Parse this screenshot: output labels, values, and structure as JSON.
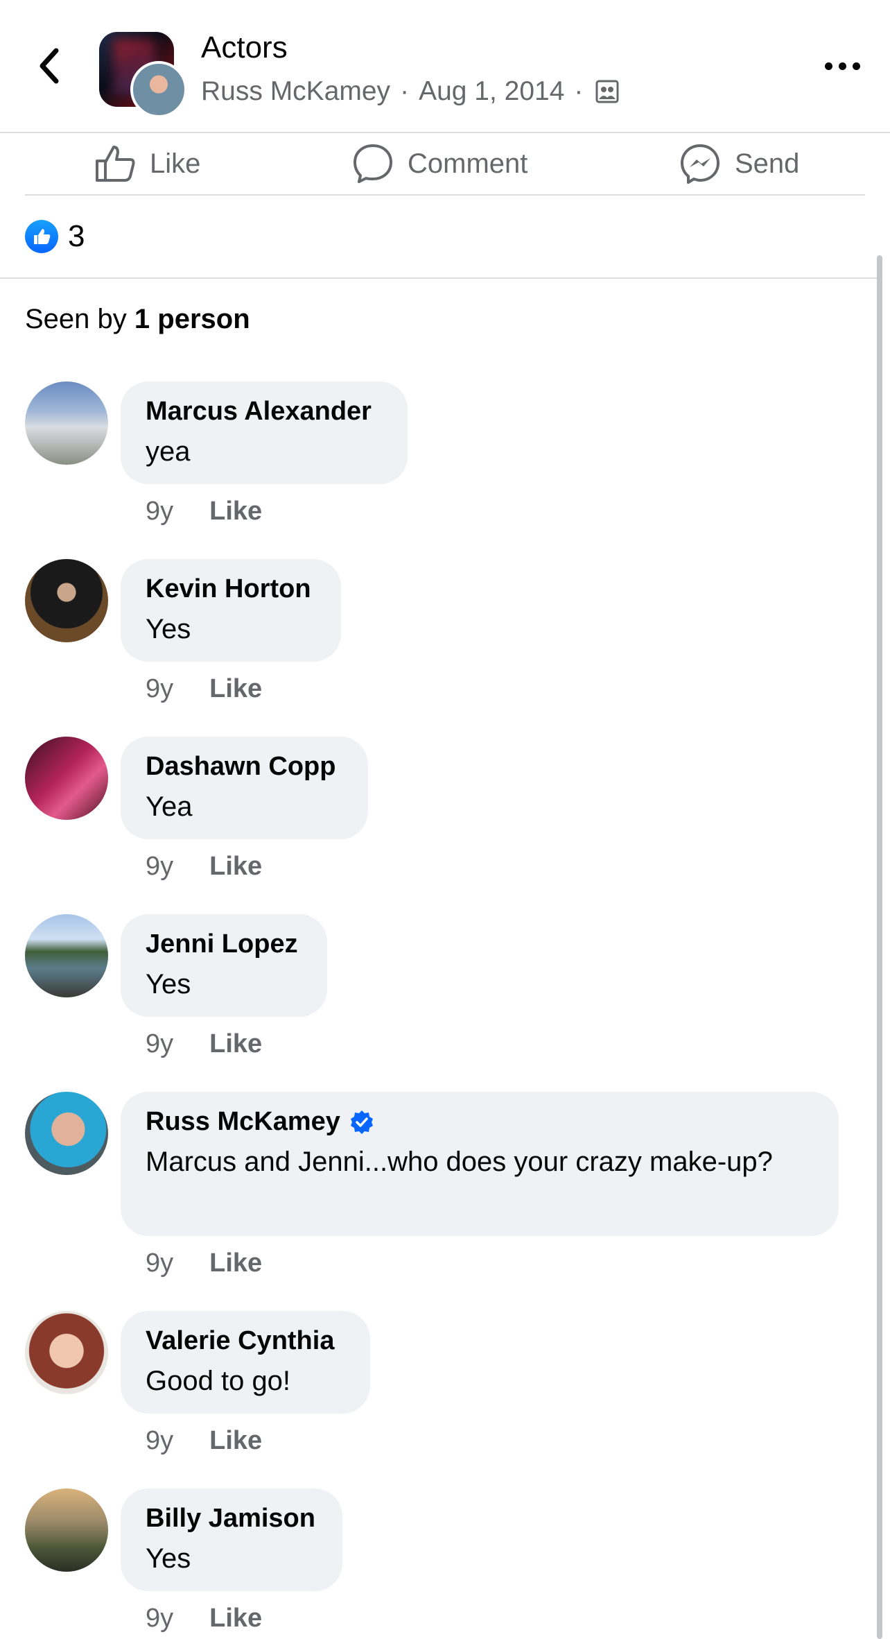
{
  "header": {
    "title": "Actors",
    "author": "Russ McKamey",
    "date": "Aug 1, 2014",
    "separator": "·",
    "audience_icon": "group-audience-icon"
  },
  "actions": {
    "like": "Like",
    "comment": "Comment",
    "send": "Send"
  },
  "reactions": {
    "count": "3"
  },
  "seen": {
    "prefix": "Seen by",
    "value": "1 person"
  },
  "comments": [
    {
      "name": "Marcus Alexander",
      "text": "yea",
      "time": "9y",
      "like": "Like"
    },
    {
      "name": "Kevin Horton",
      "text": "Yes",
      "time": "9y",
      "like": "Like"
    },
    {
      "name": "Dashawn Copp",
      "text": "Yea",
      "time": "9y",
      "like": "Like"
    },
    {
      "name": "Jenni Lopez",
      "text": "Yes",
      "time": "9y",
      "like": "Like"
    },
    {
      "name": "Russ McKamey",
      "text": "Marcus and Jenni...who does your crazy make-up?",
      "time": "9y",
      "like": "Like",
      "verified": true
    },
    {
      "name": "Valerie Cynthia",
      "text": "Good to go!",
      "time": "9y",
      "like": "Like"
    },
    {
      "name": "Billy Jamison",
      "text": "Yes",
      "time": "9y",
      "like": "Like"
    }
  ],
  "colors": {
    "accent": "#0866ff",
    "secondary_text": "#65676b",
    "bubble": "#eff1f4"
  }
}
